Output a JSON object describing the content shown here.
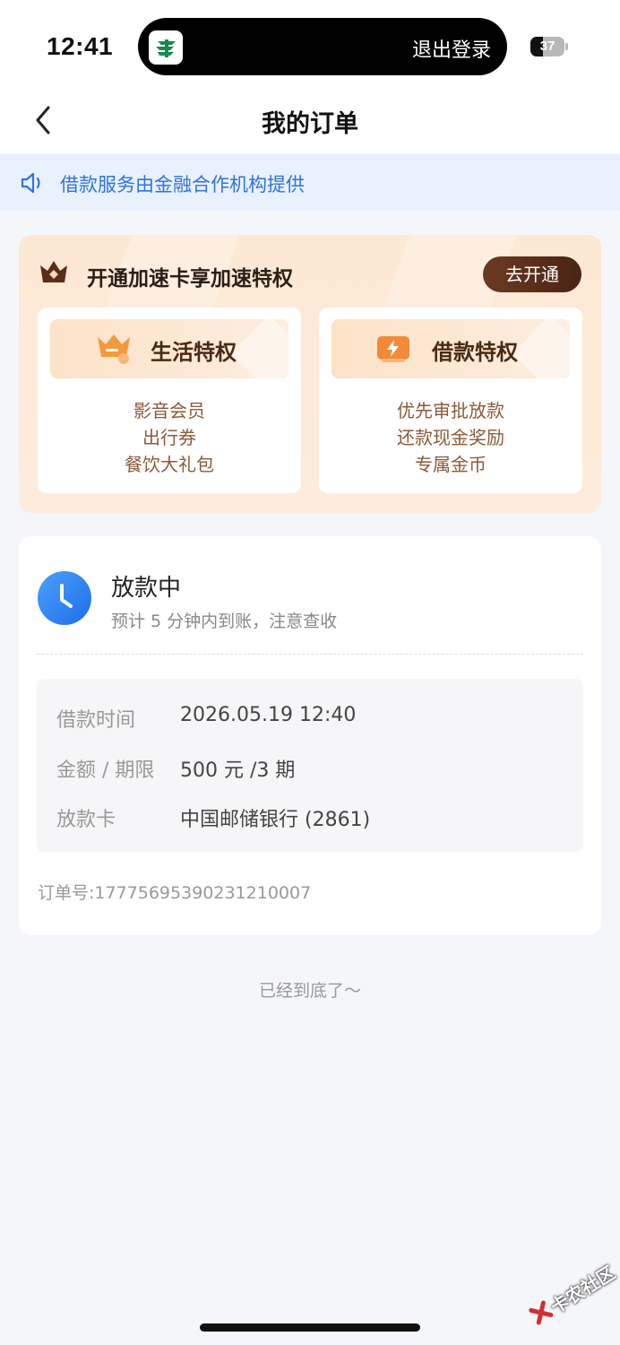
{
  "status_bar": {
    "time": "12:41",
    "island_text": "退出登录",
    "battery": "37",
    "battery_level": 0.37
  },
  "nav": {
    "title": "我的订单"
  },
  "notice": {
    "text": "借款服务由金融合作机构提供"
  },
  "promo": {
    "title": "开通加速卡享加速特权",
    "button": "去开通",
    "perks": [
      {
        "name": "生活特权",
        "items": [
          "影音会员",
          "出行券",
          "餐饮大礼包"
        ]
      },
      {
        "name": "借款特权",
        "items": [
          "优先审批放款",
          "还款现金奖励",
          "专属金币"
        ]
      }
    ]
  },
  "order": {
    "status": "放款中",
    "subtitle": "预计 5 分钟内到账，注意查收",
    "details": [
      {
        "label": "借款时间",
        "value": "2026.05.19 12:40"
      },
      {
        "label": "金额 / 期限",
        "value": "500 元 /3 期"
      },
      {
        "label": "放款卡",
        "value": "中国邮储银行 (2861)"
      }
    ],
    "order_number": "订单号:17775695390231210007"
  },
  "footer": {
    "end_text": "已经到底了～"
  },
  "watermark": {
    "text": "卡农社区"
  },
  "colors": {
    "accent_blue": "#2f73e0",
    "brown_button": "#5a2e1a",
    "promo_bg": "#fde8d5"
  }
}
